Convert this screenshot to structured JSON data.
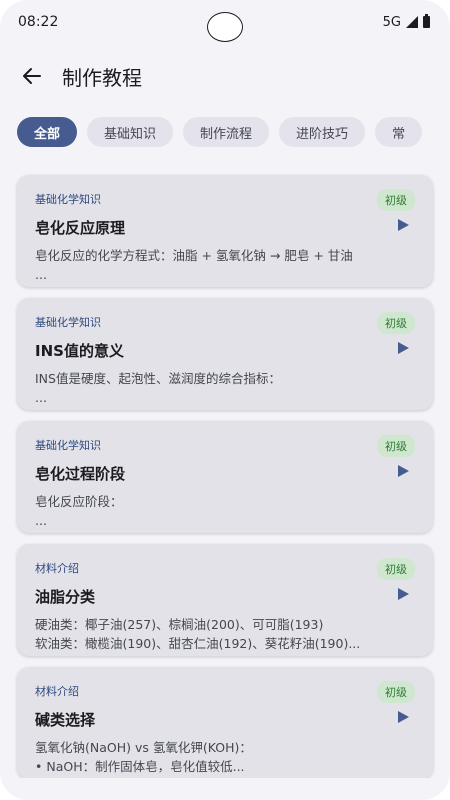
{
  "status": {
    "time": "08:22",
    "network": "5G"
  },
  "header": {
    "title": "制作教程"
  },
  "filters": [
    "全部",
    "基础知识",
    "制作流程",
    "进阶技巧",
    "常"
  ],
  "cards": [
    {
      "category": "基础化学知识",
      "level": "初级",
      "title": "皂化反应原理",
      "desc": "皂化反应的化学方程式：油脂 + 氢氧化钠 → 肥皂 + 甘油\n..."
    },
    {
      "category": "基础化学知识",
      "level": "初级",
      "title": "INS值的意义",
      "desc": "INS值是硬度、起泡性、滋润度的综合指标：\n..."
    },
    {
      "category": "基础化学知识",
      "level": "初级",
      "title": "皂化过程阶段",
      "desc": "皂化反应阶段：\n..."
    },
    {
      "category": "材料介绍",
      "level": "初级",
      "title": "油脂分类",
      "desc": "硬油类：椰子油(257)、棕榈油(200)、可可脂(193)\n软油类：橄榄油(190)、甜杏仁油(192)、葵花籽油(190)..."
    },
    {
      "category": "材料介绍",
      "level": "初级",
      "title": "碱类选择",
      "desc": "氢氧化钠(NaOH) vs 氢氧化钾(KOH)：\n• NaOH：制作固体皂，皂化值较低..."
    }
  ]
}
